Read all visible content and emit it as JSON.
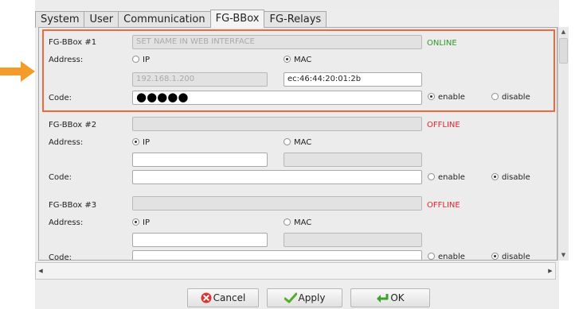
{
  "tabs": [
    "System",
    "User",
    "Communication",
    "FG-BBox",
    "FG-Relays"
  ],
  "active_tab": "FG-BBox",
  "colors": {
    "online": "#2e9a2e",
    "offline": "#e0262f",
    "highlight": "#ee6a3c",
    "arrow": "#f39c2a"
  },
  "labels": {
    "address": "Address:",
    "code": "Code:",
    "ip": "IP",
    "mac": "MAC",
    "enable": "enable",
    "disable": "disable"
  },
  "boxes": [
    {
      "title": "FG-BBox #1",
      "name_placeholder": "SET NAME IN WEB INTERFACE",
      "status": "ONLINE",
      "address_mode": "MAC",
      "ip_value": "192.168.1.200",
      "mac_value": "ec:46:44:20:01:2b",
      "code_value": "●●●●●",
      "code_state": "enable"
    },
    {
      "title": "FG-BBox #2",
      "name_placeholder": "",
      "status": "OFFLINE",
      "address_mode": "IP",
      "ip_value": "",
      "mac_value": "",
      "code_value": "",
      "code_state": "disable"
    },
    {
      "title": "FG-BBox #3",
      "name_placeholder": "",
      "status": "OFFLINE",
      "address_mode": "IP",
      "ip_value": "",
      "mac_value": "",
      "code_value": "",
      "code_state": "disable"
    }
  ],
  "buttons": {
    "cancel": "Cancel",
    "apply": "Apply",
    "ok": "OK"
  },
  "icons": {
    "cancel": "cancel-x-icon",
    "apply": "checkmark-icon",
    "ok": "ok-arrow-icon",
    "pointer": "orange-arrow-icon"
  }
}
